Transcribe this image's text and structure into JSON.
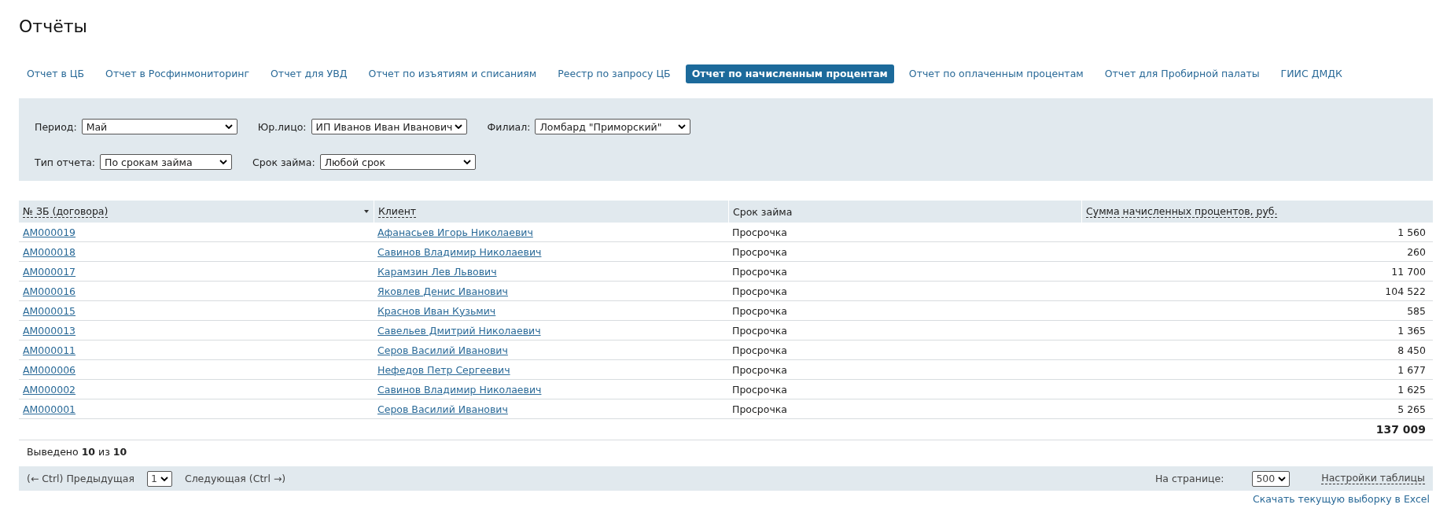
{
  "page_title": "Отчёты",
  "tabs": [
    {
      "label": "Отчет в ЦБ",
      "selected": false
    },
    {
      "label": "Отчет в Росфинмониторинг",
      "selected": false
    },
    {
      "label": "Отчет для УВД",
      "selected": false
    },
    {
      "label": "Отчет по изъятиям и списаниям",
      "selected": false
    },
    {
      "label": "Реестр по запросу ЦБ",
      "selected": false
    },
    {
      "label": "Отчет по начисленным процентам",
      "selected": true
    },
    {
      "label": "Отчет по оплаченным процентам",
      "selected": false
    },
    {
      "label": "Отчет для Пробирной палаты",
      "selected": false
    },
    {
      "label": "ГИИС ДМДК",
      "selected": false
    }
  ],
  "filter_rows": [
    [
      {
        "label": "Период:",
        "value": "Май"
      },
      {
        "label": "Юр.лицо:",
        "value": "ИП Иванов Иван Иванович"
      },
      {
        "label": "Филиал:",
        "value": "Ломбард \"Приморский\""
      }
    ],
    [
      {
        "label": "Тип отчета:",
        "value": "По срокам займа"
      },
      {
        "label": "Срок займа:",
        "value": "Любой срок"
      }
    ]
  ],
  "table": {
    "columns": [
      {
        "label": "№ ЗБ (договора)",
        "sortable": true,
        "sorted": true
      },
      {
        "label": "Клиент",
        "sortable": true,
        "sorted": false
      },
      {
        "label": "Срок займа",
        "sortable": false,
        "sorted": false
      },
      {
        "label": "Сумма начисленных процентов, руб.",
        "sortable": true,
        "sorted": false
      }
    ],
    "rows": [
      {
        "contract": "АМ000019",
        "client": "Афанасьев Игорь Николаевич",
        "term": "Просрочка",
        "amount": "1 560"
      },
      {
        "contract": "АМ000018",
        "client": "Савинов Владимир Николаевич",
        "term": "Просрочка",
        "amount": "260"
      },
      {
        "contract": "АМ000017",
        "client": "Карамзин Лев Львович",
        "term": "Просрочка",
        "amount": "11 700"
      },
      {
        "contract": "АМ000016",
        "client": "Яковлев Денис Иванович",
        "term": "Просрочка",
        "amount": "104 522"
      },
      {
        "contract": "АМ000015",
        "client": "Краснов Иван Кузьмич",
        "term": "Просрочка",
        "amount": "585"
      },
      {
        "contract": "АМ000013",
        "client": "Савельев Дмитрий Николаевич",
        "term": "Просрочка",
        "amount": "1 365"
      },
      {
        "contract": "АМ000011",
        "client": "Серов Василий Иванович",
        "term": "Просрочка",
        "amount": "8 450"
      },
      {
        "contract": "АМ000006",
        "client": "Нефедов Петр Сергеевич",
        "term": "Просрочка",
        "amount": "1 677"
      },
      {
        "contract": "АМ000002",
        "client": "Савинов Владимир Николаевич",
        "term": "Просрочка",
        "amount": "1 625"
      },
      {
        "contract": "АМ000001",
        "client": "Серов Василий Иванович",
        "term": "Просрочка",
        "amount": "5 265"
      }
    ],
    "total": "137 009"
  },
  "shown_count": "Выведено **10** из **10**",
  "pagination": {
    "prev": "(← Ctrl) Предыдущая",
    "page": "1",
    "next": "Следующая (Ctrl →)",
    "per_page_label": "На странице:",
    "per_page": "500",
    "settings": "Настройки таблицы"
  },
  "export_link": "Скачать текущую выборку в Excel"
}
